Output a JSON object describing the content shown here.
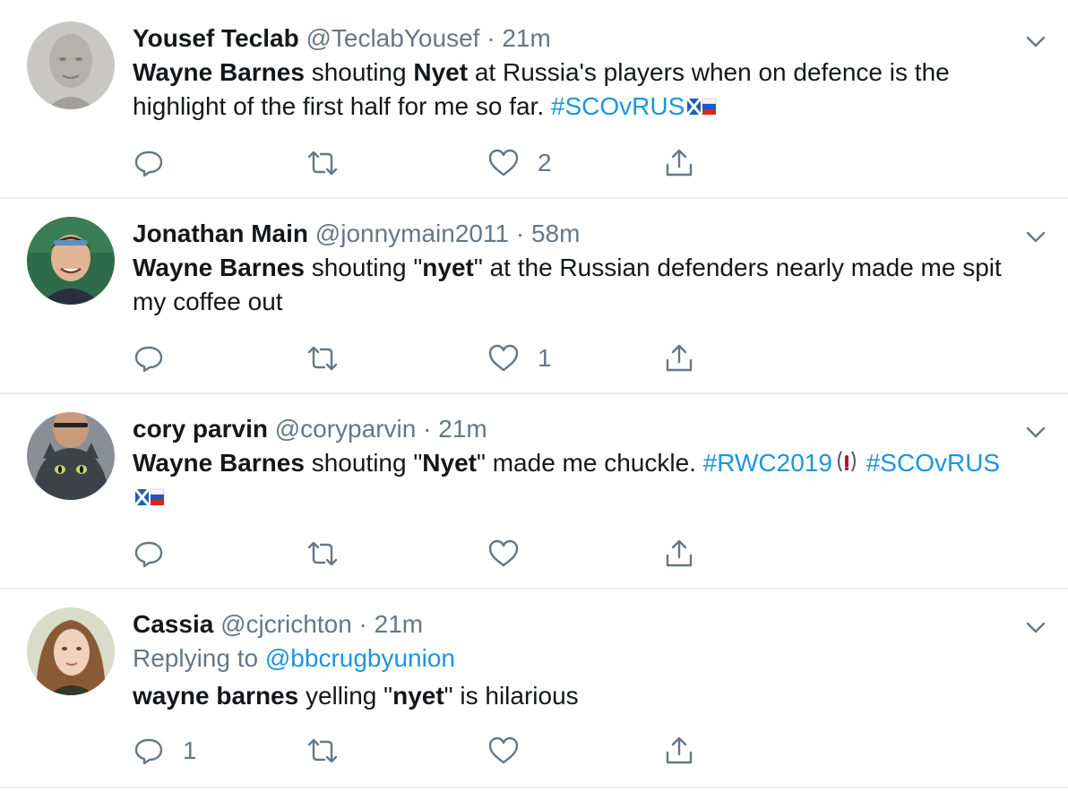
{
  "tweets": [
    {
      "name": "Yousef Teclab",
      "handle": "@TeclabYousef",
      "time": "21m",
      "body": [
        {
          "t": "Wayne Barnes",
          "s": "b"
        },
        {
          "t": " shouting ",
          "s": ""
        },
        {
          "t": "Nyet",
          "s": "b"
        },
        {
          "t": " at Russia's players when on defence is the highlight of the first half for me so far. ",
          "s": ""
        },
        {
          "t": "#SCOvRUS",
          "s": "h"
        }
      ],
      "reply_count": "",
      "retweet_count": "",
      "like_count": "2"
    },
    {
      "name": "Jonathan Main",
      "handle": "@jonnymain2011",
      "time": "58m",
      "body": [
        {
          "t": "Wayne Barnes",
          "s": "b"
        },
        {
          "t": " shouting \"",
          "s": ""
        },
        {
          "t": "nyet",
          "s": "b"
        },
        {
          "t": "\" at the Russian defenders nearly made me spit my coffee out",
          "s": ""
        }
      ],
      "reply_count": "",
      "retweet_count": "",
      "like_count": "1"
    },
    {
      "name": "cory parvin",
      "handle": "@coryparvin",
      "time": "21m",
      "body": [
        {
          "t": "Wayne Barnes",
          "s": "b"
        },
        {
          "t": " shouting \"",
          "s": ""
        },
        {
          "t": "Nyet",
          "s": "b"
        },
        {
          "t": "\" made me chuckle. ",
          "s": ""
        },
        {
          "t": "#RWC2019",
          "s": "h"
        },
        {
          "t": " #SCOvRUS",
          "s": "h"
        }
      ],
      "reply_count": "",
      "retweet_count": "",
      "like_count": ""
    },
    {
      "name": "Cassia",
      "handle": "@cjcrichton",
      "time": "21m",
      "replying_prefix": "Replying to ",
      "replying_to": "@bbcrugbyunion",
      "body": [
        {
          "t": "wayne barnes",
          "s": "b"
        },
        {
          "t": " yelling \"",
          "s": ""
        },
        {
          "t": "nyet",
          "s": "b"
        },
        {
          "t": "\" is hilarious",
          "s": ""
        }
      ],
      "reply_count": "1",
      "retweet_count": "",
      "like_count": ""
    }
  ],
  "separator": "·",
  "icons": {
    "reply": "reply-icon",
    "retweet": "retweet-icon",
    "like": "heart-icon",
    "share": "share-icon",
    "more": "chevron-down-icon"
  },
  "colors": {
    "link": "#1b95e0",
    "muted": "#657786",
    "text": "#14171a",
    "divider": "#e6ecf0"
  }
}
